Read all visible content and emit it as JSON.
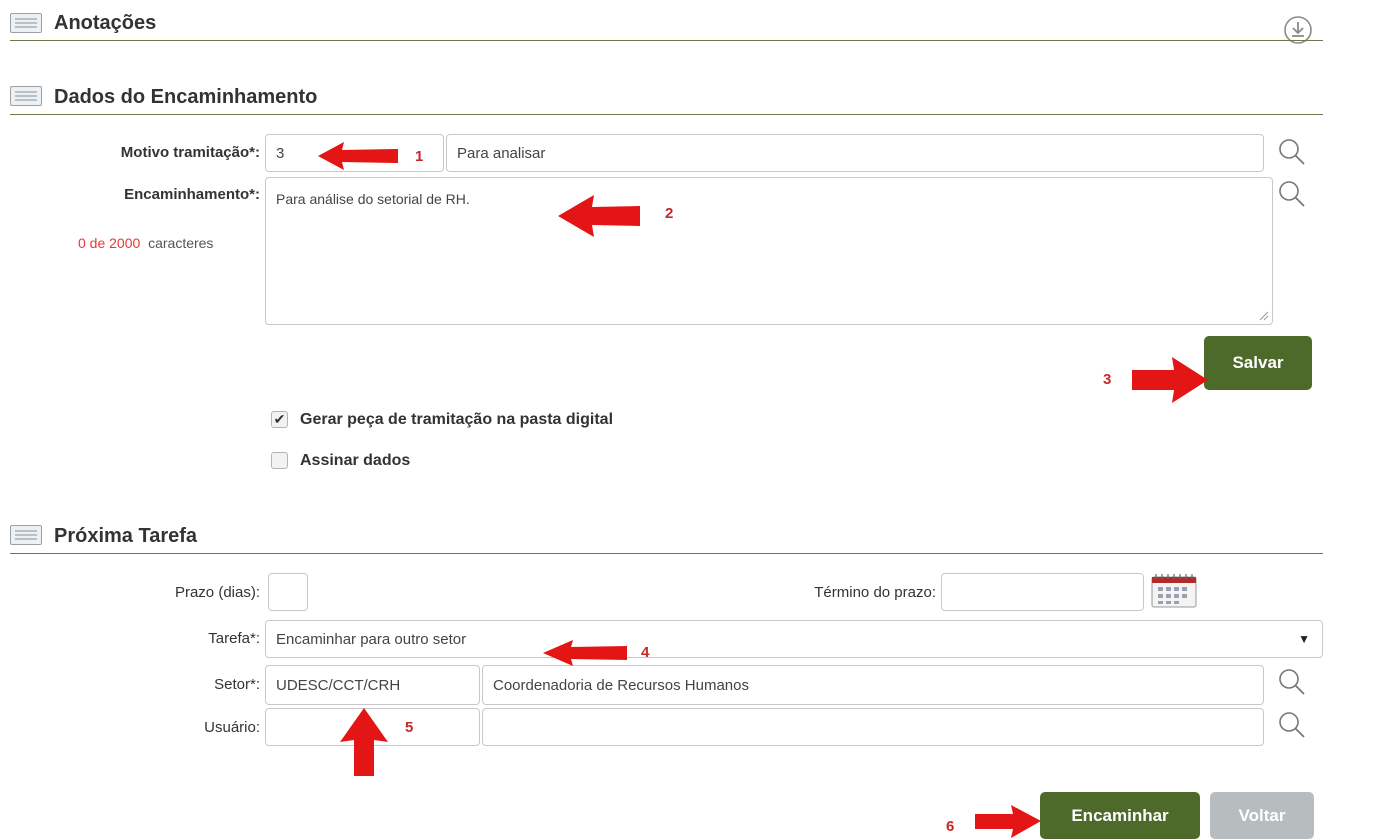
{
  "sections": {
    "anotacoes": {
      "title": "Anotações"
    },
    "dados": {
      "title": "Dados do Encaminhamento"
    },
    "proxima": {
      "title": "Próxima Tarefa"
    }
  },
  "dados": {
    "motivo_label": "Motivo tramitação*",
    "motivo_code": "3",
    "motivo_desc": "Para analisar",
    "encaminhamento_label": "Encaminhamento*",
    "encaminhamento_text": "Para análise do setorial de RH.",
    "char_count": "0 de 2000",
    "char_suffix": "caracteres",
    "save_label": "Salvar",
    "check_gerar_label": "Gerar peça de tramitação na pasta digital",
    "check_gerar_checked": true,
    "check_assinar_label": "Assinar dados",
    "check_assinar_checked": false
  },
  "proxima": {
    "prazo_label": "Prazo (dias)",
    "prazo_value": "",
    "termino_label": "Término do prazo",
    "termino_value": "",
    "tarefa_label": "Tarefa*",
    "tarefa_selected": "Encaminhar para outro setor",
    "setor_label": "Setor*",
    "setor_code": "UDESC/CCT/CRH",
    "setor_desc": "Coordenadoria de Recursos Humanos",
    "usuario_label": "Usuário",
    "usuario_code": "",
    "usuario_desc": "",
    "encaminhar_label": "Encaminhar",
    "voltar_label": "Voltar"
  },
  "annotations": [
    "1",
    "2",
    "3",
    "4",
    "5",
    "6"
  ],
  "icons": {
    "section": "list-icon",
    "download": "download-circle-icon",
    "search": "search-icon",
    "calendar": "calendar-icon",
    "dropdown": "dropdown-arrow-icon"
  },
  "colors": {
    "accent_green": "#4e6a2a",
    "disabled_gray": "#b7bcbf",
    "annotation_red": "#e31515",
    "counter_red": "#e53935"
  }
}
